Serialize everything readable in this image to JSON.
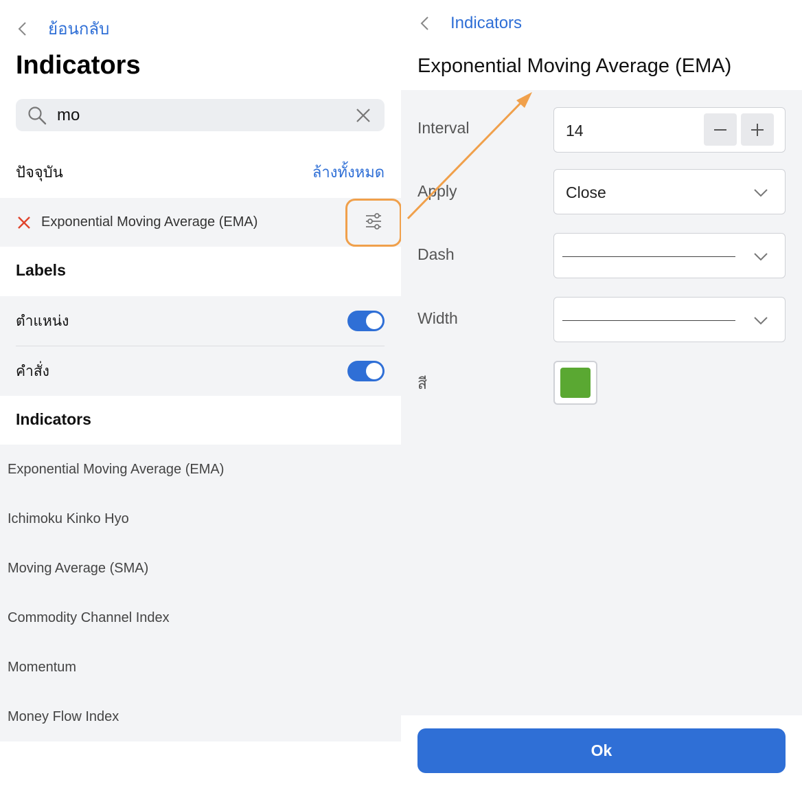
{
  "left": {
    "back_label": "ย้อนกลับ",
    "title": "Indicators",
    "search": {
      "value": "mo"
    },
    "current_label": "ปัจจุบัน",
    "clear_all_label": "ล้างทั้งหมด",
    "active_indicator": "Exponential Moving Average (EMA)",
    "labels_heading": "Labels",
    "toggles": [
      {
        "label": "ตำแหน่ง",
        "on": true
      },
      {
        "label": "คำสั่ง",
        "on": true
      }
    ],
    "indicators_heading": "Indicators",
    "indicators": [
      "Exponential Moving Average (EMA)",
      "Ichimoku Kinko Hyo",
      "Moving Average (SMA)",
      "Commodity Channel Index",
      "Momentum",
      "Money Flow Index"
    ]
  },
  "right": {
    "back_label": "Indicators",
    "title": "Exponential Moving Average (EMA)",
    "fields": {
      "interval_label": "Interval",
      "interval_value": "14",
      "apply_label": "Apply",
      "apply_value": "Close",
      "dash_label": "Dash",
      "width_label": "Width",
      "color_label": "สี"
    },
    "ok_label": "Ok"
  },
  "colors": {
    "accent": "#2f6fd6",
    "highlight": "#f0a04b",
    "swatch": "#5aa832",
    "remove": "#e0442c"
  },
  "icons": [
    "chevron-left-icon",
    "search-icon",
    "close-icon",
    "remove-icon",
    "sliders-icon",
    "minus-icon",
    "plus-icon",
    "chevron-down-icon"
  ]
}
